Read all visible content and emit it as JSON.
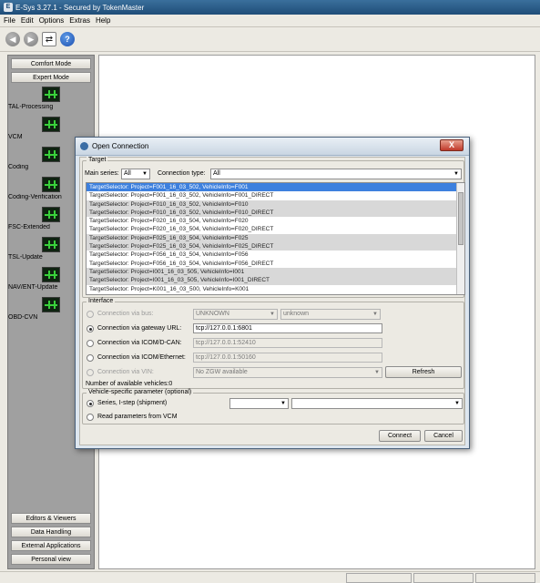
{
  "app": {
    "window_title": "E-Sys 3.27.1 - Secured by TokenMaster",
    "menu": [
      "File",
      "Edit",
      "Options",
      "Extras",
      "Help"
    ],
    "toolbar_icons": [
      "back-icon",
      "forward-icon",
      "connect-icon",
      "help-icon"
    ]
  },
  "sidebar": {
    "top_buttons": [
      "Comfort Mode",
      "Expert Mode"
    ],
    "modules": [
      "TAL-Processing",
      "VCM",
      "Coding",
      "Coding-Verification",
      "FSC-Extended",
      "TSL-Update",
      "NAV/ENT-Update",
      "OBD-CVN"
    ],
    "bottom_buttons": [
      "Editors & Viewers",
      "Data Handling",
      "External Applications",
      "Personal view"
    ]
  },
  "dialog": {
    "title": "Open Connection",
    "close": "X",
    "target": {
      "legend": "Target",
      "main_series_label": "Main series:",
      "main_series_value": "All",
      "connection_type_label": "Connection type:",
      "connection_type_value": "All",
      "list": [
        "TargetSelector: Project=F001_16_03_502, VehicleInfo=F001",
        "TargetSelector: Project=F001_16_03_502, VehicleInfo=F001_DIRECT",
        "TargetSelector: Project=F010_16_03_502, VehicleInfo=F010",
        "TargetSelector: Project=F010_16_03_502, VehicleInfo=F010_DIRECT",
        "TargetSelector: Project=F020_16_03_504, VehicleInfo=F020",
        "TargetSelector: Project=F020_16_03_504, VehicleInfo=F020_DIRECT",
        "TargetSelector: Project=F025_16_03_504, VehicleInfo=F025",
        "TargetSelector: Project=F025_16_03_504, VehicleInfo=F025_DIRECT",
        "TargetSelector: Project=F056_16_03_504, VehicleInfo=F056",
        "TargetSelector: Project=F056_16_03_504, VehicleInfo=F056_DIRECT",
        "TargetSelector: Project=I001_16_03_505, VehicleInfo=I001",
        "TargetSelector: Project=I001_16_03_505, VehicleInfo=I001_DIRECT",
        "TargetSelector: Project=K001_16_03_500, VehicleInfo=K001"
      ]
    },
    "interface": {
      "legend": "Interface",
      "bus_label": "Connection via bus:",
      "bus_value": "UNKNOWN",
      "bus_value2": "unknown",
      "gateway_label": "Connection via gateway URL:",
      "gateway_value": "tcp://127.0.0.1:6801",
      "icom_dcan_label": "Connection via ICOM/D-CAN:",
      "icom_dcan_value": "tcp://127.0.0.1:52410",
      "icom_eth_label": "Connection via ICOM/Ethernet:",
      "icom_eth_value": "tcp://127.0.0.1:50160",
      "vin_label": "Connection via VIN:",
      "vin_value": "No ZGW available",
      "refresh": "Refresh",
      "count": "Number of available vehicles:0"
    },
    "vehicle": {
      "legend": "Vehicle-specific parameter (optional)",
      "series_label": "Series, I-step (shipment)",
      "read_label": "Read parameters from VCM"
    },
    "buttons": {
      "connect": "Connect",
      "cancel": "Cancel"
    }
  }
}
